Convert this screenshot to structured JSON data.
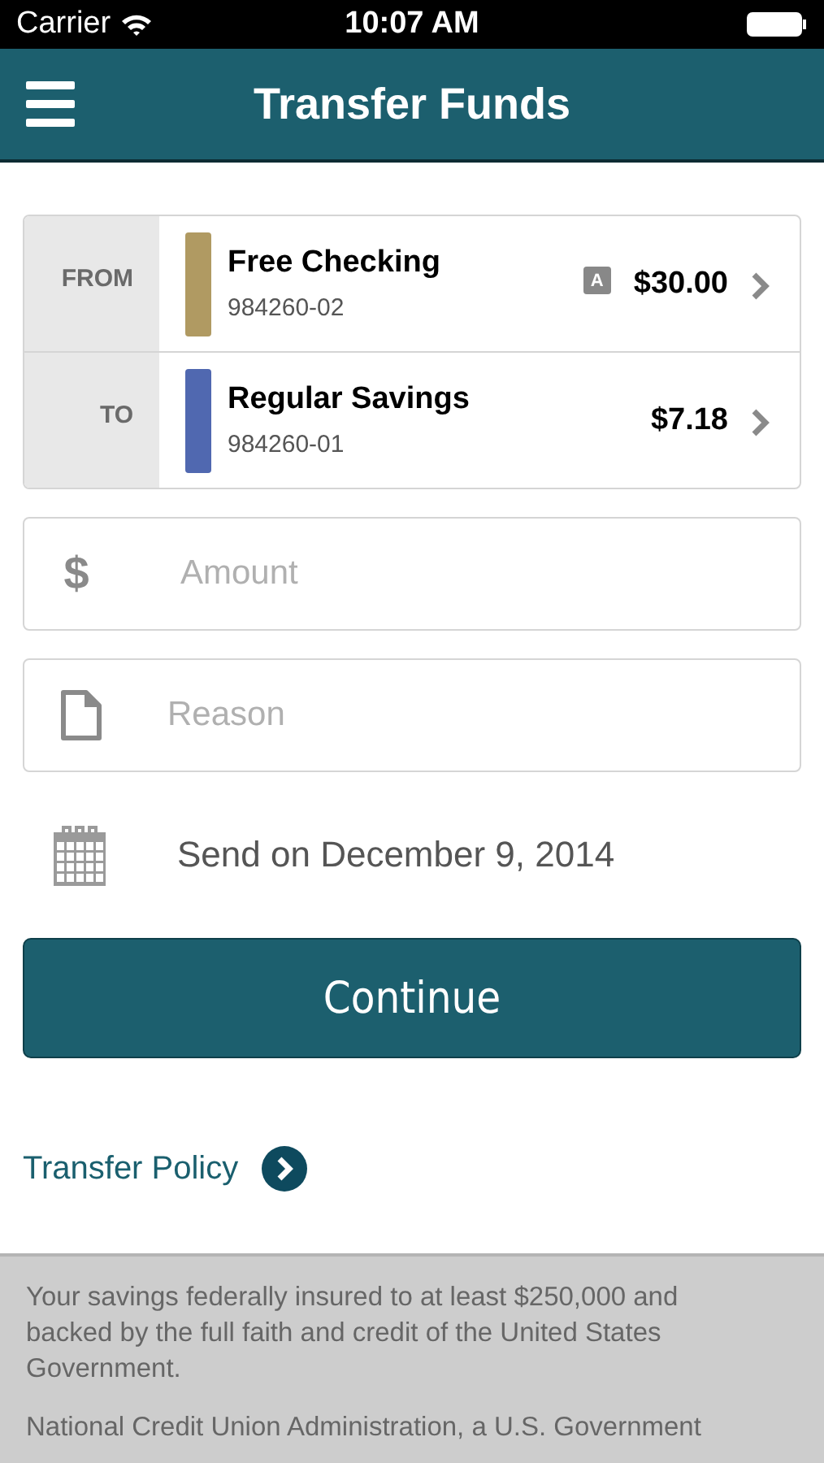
{
  "status_bar": {
    "carrier": "Carrier",
    "time": "10:07 AM"
  },
  "header": {
    "title": "Transfer Funds"
  },
  "accounts": [
    {
      "label": "FROM",
      "name": "Free Checking",
      "number": "984260-02",
      "badge": "A",
      "balance": "$30.00",
      "color": "#b09a62"
    },
    {
      "label": "TO",
      "name": "Regular Savings",
      "number": "984260-01",
      "balance": "$7.18",
      "color": "#5068b0"
    }
  ],
  "amount_field": {
    "icon": "$",
    "placeholder": "Amount"
  },
  "reason_field": {
    "placeholder": "Reason"
  },
  "send_date": "Send on December 9, 2014",
  "continue_button": "Continue",
  "policy_link": "Transfer Policy",
  "footer": [
    "Your savings federally insured to at least $250,000 and backed by the full faith and credit of the United States Government.",
    "National Credit Union Administration, a U.S. Government"
  ]
}
